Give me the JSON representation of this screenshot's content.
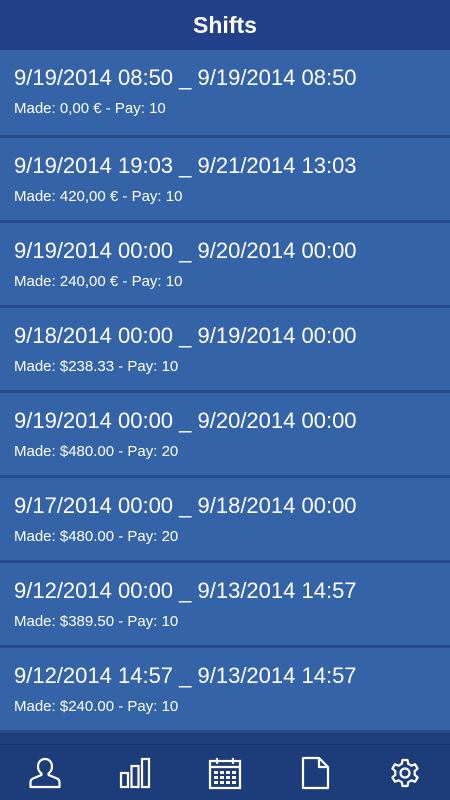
{
  "header": {
    "title": "Shifts"
  },
  "shifts": [
    {
      "dates": "9/19/2014 08:50 _ 9/19/2014 08:50",
      "details": "Made: 0,00 € - Pay: 10"
    },
    {
      "dates": "9/19/2014 19:03 _ 9/21/2014 13:03",
      "details": "Made: 420,00 € - Pay: 10"
    },
    {
      "dates": "9/19/2014 00:00 _ 9/20/2014 00:00",
      "details": "Made: 240,00 € - Pay: 10"
    },
    {
      "dates": "9/18/2014 00:00 _ 9/19/2014 00:00",
      "details": "Made: $238.33 - Pay: 10"
    },
    {
      "dates": "9/19/2014 00:00 _ 9/20/2014 00:00",
      "details": "Made: $480.00 - Pay: 20"
    },
    {
      "dates": "9/17/2014 00:00 _ 9/18/2014 00:00",
      "details": "Made: $480.00 - Pay: 20"
    },
    {
      "dates": "9/12/2014 00:00 _ 9/13/2014 14:57",
      "details": "Made: $389.50 - Pay: 10"
    },
    {
      "dates": "9/12/2014 14:57 _ 9/13/2014 14:57",
      "details": "Made: $240.00 - Pay: 10"
    }
  ],
  "nav": [
    {
      "icon": "user-icon"
    },
    {
      "icon": "bar-chart-icon"
    },
    {
      "icon": "calendar-icon"
    },
    {
      "icon": "document-icon"
    },
    {
      "icon": "gear-icon"
    }
  ],
  "colors": {
    "header_bg": "#23418a",
    "row_bg": "#3463a8",
    "row_border": "#274c8d",
    "nav_bg": "#1d3c7a",
    "text": "#ffffff"
  }
}
